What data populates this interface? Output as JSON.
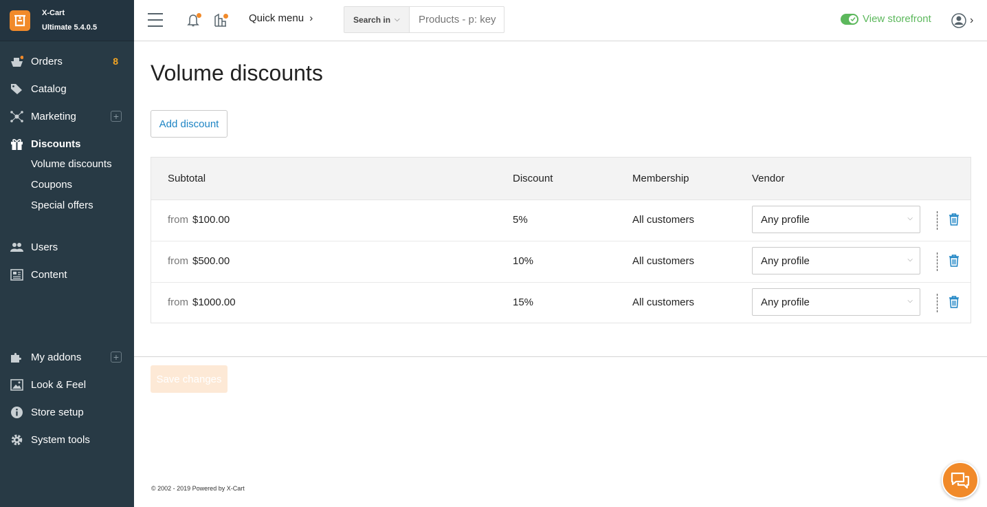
{
  "brand": {
    "name": "X-Cart",
    "version": "Ultimate 5.4.0.5"
  },
  "sidebar": {
    "items": [
      {
        "label": "Orders",
        "icon": "orders-icon",
        "badge": "8"
      },
      {
        "label": "Catalog",
        "icon": "tag-icon"
      },
      {
        "label": "Marketing",
        "icon": "marketing-icon"
      },
      {
        "label": "Discounts",
        "icon": "gift-icon",
        "active": true
      },
      {
        "label": "Users",
        "icon": "users-icon"
      },
      {
        "label": "Content",
        "icon": "content-icon"
      }
    ],
    "sub_items": [
      "Volume discounts",
      "Coupons",
      "Special offers"
    ],
    "bottom_items": [
      {
        "label": "My addons",
        "icon": "puzzle-icon"
      },
      {
        "label": "Look & Feel",
        "icon": "image-icon"
      },
      {
        "label": "Store setup",
        "icon": "info-icon"
      },
      {
        "label": "System tools",
        "icon": "gear-icon"
      }
    ]
  },
  "header": {
    "quick_menu": "Quick menu",
    "search_in": "Search in",
    "search_placeholder": "Products - p: key",
    "view_storefront": "View storefront"
  },
  "main": {
    "title": "Volume discounts",
    "add_button": "Add discount",
    "save_button": "Save changes"
  },
  "table": {
    "headers": [
      "Subtotal",
      "Discount",
      "Membership",
      "Vendor"
    ],
    "rows": [
      {
        "from": "from",
        "subtotal": "$100.00",
        "discount": "5%",
        "membership": "All customers",
        "vendor": "Any profile"
      },
      {
        "from": "from",
        "subtotal": "$500.00",
        "discount": "10%",
        "membership": "All customers",
        "vendor": "Any profile"
      },
      {
        "from": "from",
        "subtotal": "$1000.00",
        "discount": "15%",
        "membership": "All customers",
        "vendor": "Any profile"
      }
    ]
  },
  "footer": {
    "text": "© 2002 - 2019 Powered by X-Cart"
  },
  "colors": {
    "sidebar_bg": "#283a45",
    "accent": "#f18a2a",
    "link": "#1d84c4",
    "green": "#5cb85c",
    "badge": "#f5a623"
  }
}
